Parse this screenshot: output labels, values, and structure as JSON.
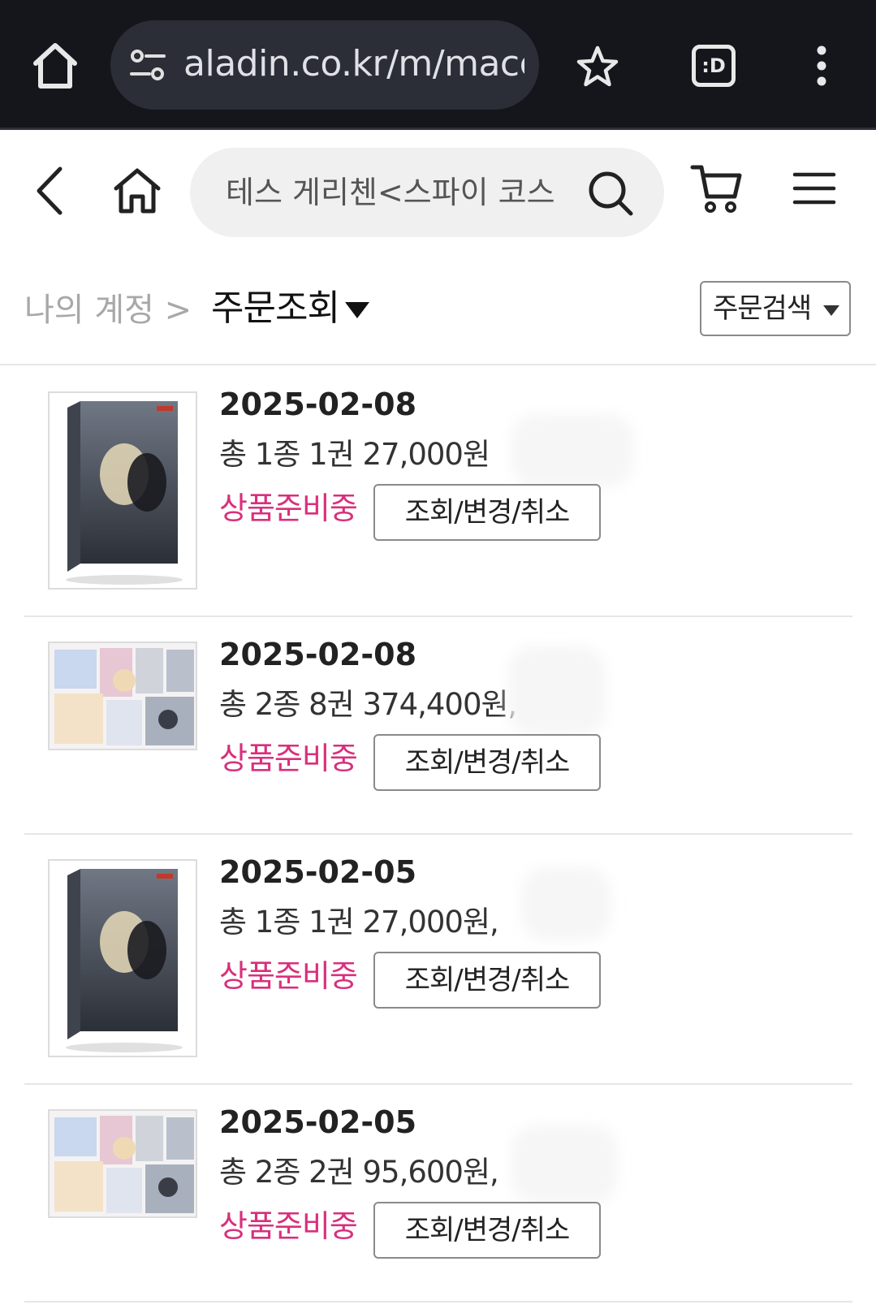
{
  "browser": {
    "url": "aladin.co.kr/m/macc",
    "tab_switcher_label": ":D",
    "icons": {
      "home": "home-icon",
      "site_info": "tune-icon",
      "bookmark": "star-icon",
      "menu": "more-vert-icon"
    }
  },
  "header": {
    "search_value": "테스 게리첸<스파이 코스",
    "icons": {
      "back": "chevron-left-icon",
      "home": "home-icon",
      "search": "search-icon",
      "cart": "cart-icon",
      "menu": "hamburger-icon"
    }
  },
  "page": {
    "breadcrumb": "나의 계정 >",
    "title": "주문조회",
    "order_search_label": "주문검색"
  },
  "orders": [
    {
      "date": "2025-02-08",
      "summary": "총 1종 1권 27,000원",
      "status": "상품준비중",
      "action": "조회/변경/취소",
      "thumb": "book-box"
    },
    {
      "date": "2025-02-08",
      "summary": "총 2종 8권 374,400원,",
      "status": "상품준비중",
      "action": "조회/변경/취소",
      "thumb": "goods-set"
    },
    {
      "date": "2025-02-05",
      "summary": "총 1종 1권 27,000원,",
      "status": "상품준비중",
      "action": "조회/변경/취소",
      "thumb": "book-box"
    },
    {
      "date": "2025-02-05",
      "summary": "총 2종 2권 95,600원,",
      "status": "상품준비중",
      "action": "조회/변경/취소",
      "thumb": "goods-set"
    }
  ],
  "colors": {
    "status": "#d8307c",
    "browser_bg": "#14161c"
  }
}
